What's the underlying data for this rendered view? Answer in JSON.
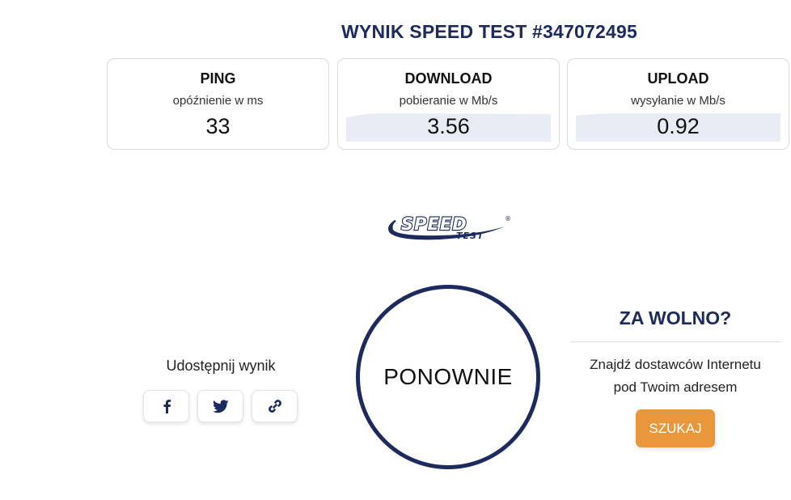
{
  "title": "WYNIK SPEED TEST #347072495",
  "results": {
    "ping": {
      "label": "PING",
      "sub": "opóźnienie w ms",
      "value": "33"
    },
    "download": {
      "label": "DOWNLOAD",
      "sub": "pobieranie w Mb/s",
      "value": "3.56"
    },
    "upload": {
      "label": "UPLOAD",
      "sub": "wysyłanie w Mb/s",
      "value": "0.92"
    }
  },
  "logo": {
    "main": "SPEED",
    "sub": "TEST",
    "mark": "®"
  },
  "share": {
    "label": "Udostępnij wynik",
    "buttons": [
      "facebook-icon",
      "twitter-icon",
      "link-icon"
    ]
  },
  "again_label": "PONOWNIE",
  "slow": {
    "title": "ZA WOLNO?",
    "line1": "Znajdź dostawców Internetu",
    "line2": "pod Twoim adresem",
    "button": "SZUKAJ"
  },
  "colors": {
    "navy": "#1c2a5e",
    "accent": "#e8973a",
    "graph": "#e9ecf5"
  }
}
